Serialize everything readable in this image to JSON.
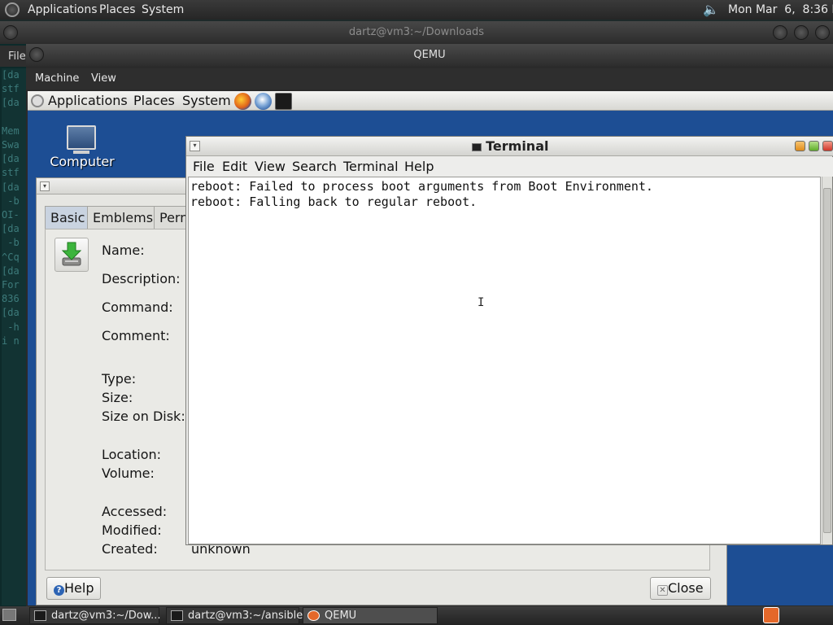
{
  "host_panel": {
    "menus": [
      "Applications",
      "Places",
      "System"
    ],
    "clock": "Mon Mar  6,  8:36 PM"
  },
  "host_terminal": {
    "title": "dartz@vm3:~/Downloads",
    "menu_file": "File",
    "lines": [
      "[da",
      "stf",
      "[da",
      "",
      "Mem",
      "Swa",
      "[da",
      "stf",
      "[da",
      " -b",
      "OI-",
      "[da",
      " -b",
      "^Cq",
      "[da",
      "For",
      "836",
      "[da",
      " -h",
      "i n"
    ]
  },
  "qemu": {
    "title": "QEMU",
    "menus": [
      "Machine",
      "View"
    ]
  },
  "guest_panel": {
    "menus": [
      "Applications",
      "Places",
      "System"
    ]
  },
  "desktop": {
    "computer_label": "Computer"
  },
  "properties_dialog": {
    "tabs": [
      "Basic",
      "Emblems",
      "Perm"
    ],
    "labels": {
      "name": "Name:",
      "description": "Description:",
      "command": "Command:",
      "comment": "Comment:",
      "type": "Type:",
      "size": "Size:",
      "size_on_disk": "Size on Disk:",
      "location": "Location:",
      "volume": "Volume:",
      "accessed": "Accessed:",
      "modified": "Modified:",
      "created": "Created:"
    },
    "created_value": "unknown",
    "help_button": "Help",
    "close_button": "Close"
  },
  "terminal": {
    "title": "Terminal",
    "menus": [
      "File",
      "Edit",
      "View",
      "Search",
      "Terminal",
      "Help"
    ],
    "output": "reboot: Failed to process boot arguments from Boot Environment.\nreboot: Falling back to regular reboot."
  },
  "taskbar": {
    "tasks": [
      "dartz@vm3:~/Dow...",
      "dartz@vm3:~/ansible",
      "QEMU"
    ]
  }
}
